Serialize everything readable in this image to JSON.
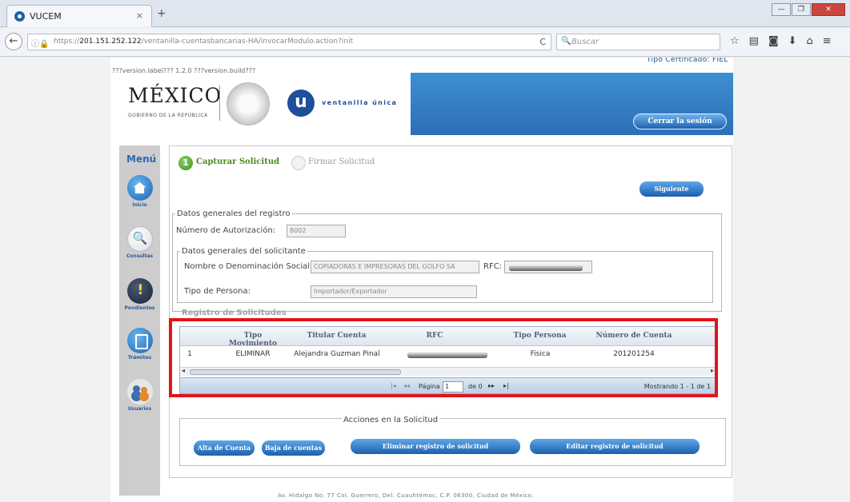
{
  "browser": {
    "tab_title": "VUCEM",
    "tab_close": "×",
    "new_tab": "+",
    "url_prefix": "https://",
    "url_host": "201.151.252.122",
    "url_path": "/ventanilla-cuentasbancarias-HA/invocarModulo.action?init",
    "search_placeholder": "Buscar",
    "reload": "C"
  },
  "page": {
    "version": "???version.label??? 1.2.0 ???version.build???",
    "cert_type": "Tipo Certificado: FIEL",
    "header": {
      "mexico": "MÉXICO",
      "gobierno": "GOBIERNO DE LA REPÚBLICA",
      "vu_letter": "u",
      "vu_text": "ventanilla única",
      "logout": "Cerrar la sesión"
    },
    "menu": {
      "title": "Menú",
      "items": [
        {
          "label": "Inicio",
          "icon": "home-icon"
        },
        {
          "label": "Consultas",
          "icon": "search-icon"
        },
        {
          "label": "Pendientes",
          "icon": "alert-icon"
        },
        {
          "label": "Trámites",
          "icon": "document-icon"
        },
        {
          "label": "Usuarios",
          "icon": "users-icon"
        }
      ]
    },
    "steps": {
      "step1_num": "1",
      "step1_label": "Capturar Solicitud",
      "step2_label": "Firmar Solicitud",
      "next": "Siguiente"
    },
    "registro": {
      "legend": "Datos generales del registro",
      "auth_label": "Número de Autorización:",
      "auth_value": "8002"
    },
    "solicitante": {
      "legend": "Datos generales del solicitante",
      "name_label": "Nombre o Denominación Social:",
      "name_value": "COPIADORAS E IMPRESORAS DEL GOLFO SA",
      "rfc_label": "RFC:",
      "tipo_label": "Tipo de Persona:",
      "tipo_value": "Importador/Exportador"
    },
    "grid": {
      "caption": "Registro de Solicitudes",
      "columns": [
        "Tipo Movimiento",
        "Titular Cuenta",
        "RFC",
        "Tipo Persona",
        "Número de Cuenta"
      ],
      "rows": [
        {
          "num": "1",
          "movimiento": "ELIMINAR",
          "titular": "Alejandra Guzman Pinal",
          "tipo_persona": "Fisica",
          "cuenta": "201201254"
        }
      ],
      "pager": {
        "first": "|◂",
        "prev": "◂◂",
        "page_label": "Página",
        "page_value": "1",
        "of_label": "de 0",
        "next": "▸▸",
        "last": "▸|",
        "info": "Mostrando 1 - 1 de 1"
      },
      "scroll_left": "◂",
      "scroll_right": "▸",
      "scroll_grip": "III"
    },
    "actions": {
      "legend": "Acciones en la Solicitud",
      "alta": "Alta de Cuenta",
      "baja": "Baja de cuentas",
      "eliminar": "Eliminar registro de solicitud",
      "editar": "Editar registro de solicitud"
    },
    "footer": "Av. Hidalgo No. 77 Col. Guerrero, Del. Cuauhtémoc, C.P. 06300, Ciudad de México."
  }
}
